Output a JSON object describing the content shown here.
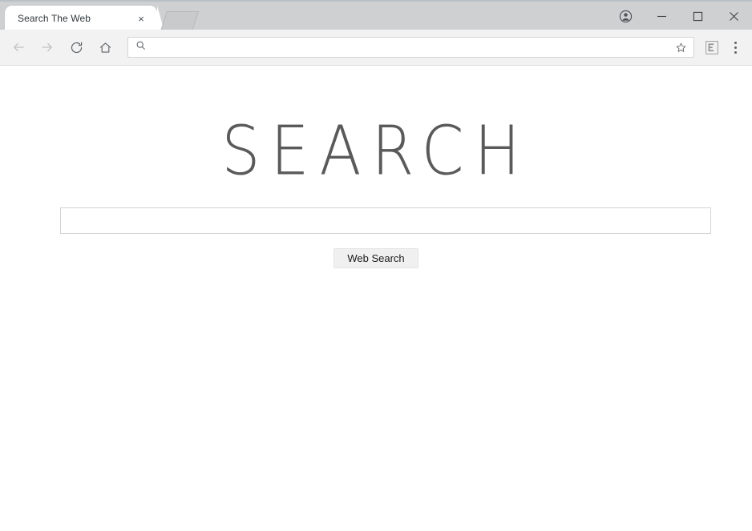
{
  "window": {
    "controls": {
      "profile_label": "Profile",
      "minimize_label": "Minimize",
      "maximize_label": "Maximize",
      "close_label": "Close"
    }
  },
  "tabstrip": {
    "tabs": [
      {
        "title": "Search The Web",
        "close_label": "×",
        "active": true
      }
    ],
    "new_tab_label": "New Tab"
  },
  "toolbar": {
    "back_label": "Back",
    "forward_label": "Forward",
    "reload_label": "Reload",
    "home_label": "Home",
    "omnibox": {
      "value": "",
      "placeholder": "",
      "search_icon": "search-icon",
      "bookmark_icon": "star-icon"
    },
    "extension_label": "E",
    "menu_label": "Customize and control"
  },
  "page": {
    "logo_text": "SEARCH",
    "search_field": {
      "value": "",
      "placeholder": ""
    },
    "search_button_label": "Web Search"
  },
  "colors": {
    "titlebar": "#cfd0d1",
    "toolbar": "#f2f2f2",
    "logo_grey": "#5a5a5a",
    "button_grey": "#f0f0f0",
    "page_bg": "#ffffff"
  }
}
